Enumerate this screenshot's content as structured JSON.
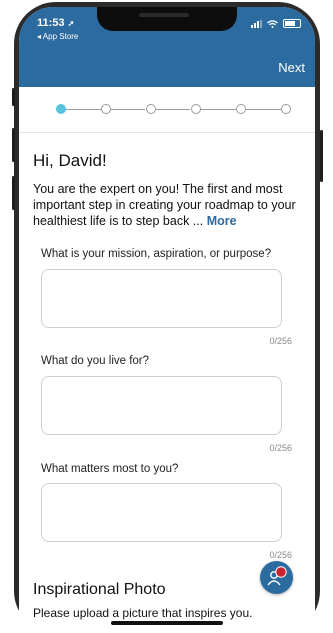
{
  "status_bar": {
    "time": "11:53",
    "back_label": "◂ App Store"
  },
  "header": {
    "next_label": "Next"
  },
  "stepper": {
    "total_steps": 6,
    "current_step": 1
  },
  "content": {
    "greeting": "Hi, David!",
    "intro": "You are the expert on you! The first and most important step in creating your roadmap to your healthiest life is to step back ...",
    "more_label": "More"
  },
  "questions": [
    {
      "label": "What is your mission, aspiration, or purpose?",
      "value": "",
      "count": "0/256"
    },
    {
      "label": "What do you live for?",
      "value": "",
      "count": "0/256"
    },
    {
      "label": "What matters most to you?",
      "value": "",
      "count": "0/256"
    }
  ],
  "photo_section": {
    "title": "Inspirational Photo",
    "description": "Please upload a picture that inspires you."
  },
  "colors": {
    "brand": "#2c6ba0",
    "step_active": "#57c3dc",
    "fab_badge": "#c8232c"
  }
}
